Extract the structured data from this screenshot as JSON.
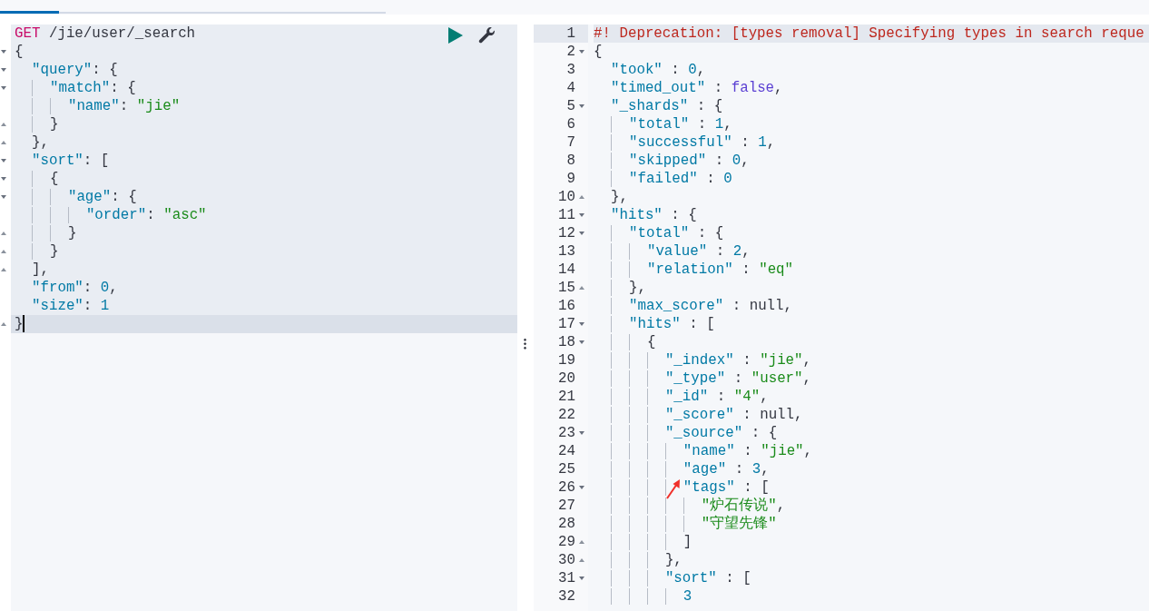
{
  "request_editor": {
    "lines": [
      {
        "kind": "plain",
        "current": false,
        "tokens": [
          {
            "kind": "method",
            "text": "GET"
          },
          {
            "kind": "url",
            "text": " /jie/user/_search"
          }
        ]
      },
      {
        "kind": "open",
        "current": false,
        "tokens": [
          {
            "kind": "punct",
            "text": "{"
          }
        ]
      },
      {
        "kind": "open",
        "current": false,
        "tokens": [
          {
            "kind": "key",
            "text": "  \"query\""
          },
          {
            "kind": "punct",
            "text": ": {"
          }
        ]
      },
      {
        "kind": "open",
        "current": false,
        "tokens": [
          {
            "kind": "key",
            "text": "    \"match\""
          },
          {
            "kind": "punct",
            "text": ": {"
          }
        ]
      },
      {
        "kind": "plain",
        "current": false,
        "tokens": [
          {
            "kind": "key",
            "text": "      \"name\""
          },
          {
            "kind": "punct",
            "text": ": "
          },
          {
            "kind": "string",
            "text": "\"jie\""
          }
        ]
      },
      {
        "kind": "close",
        "current": false,
        "tokens": [
          {
            "kind": "punct",
            "text": "    }"
          }
        ]
      },
      {
        "kind": "close",
        "current": false,
        "tokens": [
          {
            "kind": "punct",
            "text": "  },"
          }
        ]
      },
      {
        "kind": "open",
        "current": false,
        "tokens": [
          {
            "kind": "key",
            "text": "  \"sort\""
          },
          {
            "kind": "punct",
            "text": ": ["
          }
        ]
      },
      {
        "kind": "open",
        "current": false,
        "tokens": [
          {
            "kind": "punct",
            "text": "    {"
          }
        ]
      },
      {
        "kind": "open",
        "current": false,
        "tokens": [
          {
            "kind": "key",
            "text": "      \"age\""
          },
          {
            "kind": "punct",
            "text": ": {"
          }
        ]
      },
      {
        "kind": "plain",
        "current": false,
        "tokens": [
          {
            "kind": "key",
            "text": "        \"order\""
          },
          {
            "kind": "punct",
            "text": ": "
          },
          {
            "kind": "string",
            "text": "\"asc\""
          }
        ]
      },
      {
        "kind": "close",
        "current": false,
        "tokens": [
          {
            "kind": "punct",
            "text": "      }"
          }
        ]
      },
      {
        "kind": "close",
        "current": false,
        "tokens": [
          {
            "kind": "punct",
            "text": "    }"
          }
        ]
      },
      {
        "kind": "close",
        "current": false,
        "tokens": [
          {
            "kind": "punct",
            "text": "  ],"
          }
        ]
      },
      {
        "kind": "plain",
        "current": false,
        "tokens": [
          {
            "kind": "key",
            "text": "  \"from\""
          },
          {
            "kind": "punct",
            "text": ": "
          },
          {
            "kind": "number",
            "text": "0"
          },
          {
            "kind": "punct",
            "text": ","
          }
        ]
      },
      {
        "kind": "plain",
        "current": false,
        "tokens": [
          {
            "kind": "key",
            "text": "  \"size\""
          },
          {
            "kind": "punct",
            "text": ": "
          },
          {
            "kind": "number",
            "text": "1"
          }
        ]
      },
      {
        "kind": "close",
        "current": true,
        "tokens": [
          {
            "kind": "punct",
            "text": "}"
          }
        ]
      }
    ]
  },
  "response_viewer": {
    "lines": [
      {
        "number": "1",
        "kind": "plain",
        "current": true,
        "tokens": [
          {
            "kind": "comment",
            "text": "#! Deprecation: [types removal] Specifying types in search reque"
          }
        ]
      },
      {
        "number": "2",
        "kind": "open",
        "current": false,
        "tokens": [
          {
            "kind": "punct",
            "text": "{"
          }
        ]
      },
      {
        "number": "3",
        "kind": "plain",
        "current": false,
        "tokens": [
          {
            "kind": "key",
            "text": "  \"took\""
          },
          {
            "kind": "punct",
            "text": " : "
          },
          {
            "kind": "number",
            "text": "0"
          },
          {
            "kind": "punct",
            "text": ","
          }
        ]
      },
      {
        "number": "4",
        "kind": "plain",
        "current": false,
        "tokens": [
          {
            "kind": "key",
            "text": "  \"timed_out\""
          },
          {
            "kind": "punct",
            "text": " : "
          },
          {
            "kind": "bool",
            "text": "false"
          },
          {
            "kind": "punct",
            "text": ","
          }
        ]
      },
      {
        "number": "5",
        "kind": "open",
        "current": false,
        "tokens": [
          {
            "kind": "key",
            "text": "  \"_shards\""
          },
          {
            "kind": "punct",
            "text": " : {"
          }
        ]
      },
      {
        "number": "6",
        "kind": "plain",
        "current": false,
        "tokens": [
          {
            "kind": "key",
            "text": "    \"total\""
          },
          {
            "kind": "punct",
            "text": " : "
          },
          {
            "kind": "number",
            "text": "1"
          },
          {
            "kind": "punct",
            "text": ","
          }
        ]
      },
      {
        "number": "7",
        "kind": "plain",
        "current": false,
        "tokens": [
          {
            "kind": "key",
            "text": "    \"successful\""
          },
          {
            "kind": "punct",
            "text": " : "
          },
          {
            "kind": "number",
            "text": "1"
          },
          {
            "kind": "punct",
            "text": ","
          }
        ]
      },
      {
        "number": "8",
        "kind": "plain",
        "current": false,
        "tokens": [
          {
            "kind": "key",
            "text": "    \"skipped\""
          },
          {
            "kind": "punct",
            "text": " : "
          },
          {
            "kind": "number",
            "text": "0"
          },
          {
            "kind": "punct",
            "text": ","
          }
        ]
      },
      {
        "number": "9",
        "kind": "plain",
        "current": false,
        "tokens": [
          {
            "kind": "key",
            "text": "    \"failed\""
          },
          {
            "kind": "punct",
            "text": " : "
          },
          {
            "kind": "number",
            "text": "0"
          }
        ]
      },
      {
        "number": "10",
        "kind": "close",
        "current": false,
        "tokens": [
          {
            "kind": "punct",
            "text": "  },"
          }
        ]
      },
      {
        "number": "11",
        "kind": "open",
        "current": false,
        "tokens": [
          {
            "kind": "key",
            "text": "  \"hits\""
          },
          {
            "kind": "punct",
            "text": " : {"
          }
        ]
      },
      {
        "number": "12",
        "kind": "open",
        "current": false,
        "tokens": [
          {
            "kind": "key",
            "text": "    \"total\""
          },
          {
            "kind": "punct",
            "text": " : {"
          }
        ]
      },
      {
        "number": "13",
        "kind": "plain",
        "current": false,
        "tokens": [
          {
            "kind": "key",
            "text": "      \"value\""
          },
          {
            "kind": "punct",
            "text": " : "
          },
          {
            "kind": "number",
            "text": "2"
          },
          {
            "kind": "punct",
            "text": ","
          }
        ]
      },
      {
        "number": "14",
        "kind": "plain",
        "current": false,
        "tokens": [
          {
            "kind": "key",
            "text": "      \"relation\""
          },
          {
            "kind": "punct",
            "text": " : "
          },
          {
            "kind": "string",
            "text": "\"eq\""
          }
        ]
      },
      {
        "number": "15",
        "kind": "close",
        "current": false,
        "tokens": [
          {
            "kind": "punct",
            "text": "    },"
          }
        ]
      },
      {
        "number": "16",
        "kind": "plain",
        "current": false,
        "tokens": [
          {
            "kind": "key",
            "text": "    \"max_score\""
          },
          {
            "kind": "punct",
            "text": " : null,"
          }
        ]
      },
      {
        "number": "17",
        "kind": "open",
        "current": false,
        "tokens": [
          {
            "kind": "key",
            "text": "    \"hits\""
          },
          {
            "kind": "punct",
            "text": " : ["
          }
        ]
      },
      {
        "number": "18",
        "kind": "open",
        "current": false,
        "tokens": [
          {
            "kind": "punct",
            "text": "      {"
          }
        ]
      },
      {
        "number": "19",
        "kind": "plain",
        "current": false,
        "tokens": [
          {
            "kind": "key",
            "text": "        \"_index\""
          },
          {
            "kind": "punct",
            "text": " : "
          },
          {
            "kind": "string",
            "text": "\"jie\""
          },
          {
            "kind": "punct",
            "text": ","
          }
        ]
      },
      {
        "number": "20",
        "kind": "plain",
        "current": false,
        "tokens": [
          {
            "kind": "key",
            "text": "        \"_type\""
          },
          {
            "kind": "punct",
            "text": " : "
          },
          {
            "kind": "string",
            "text": "\"user\""
          },
          {
            "kind": "punct",
            "text": ","
          }
        ]
      },
      {
        "number": "21",
        "kind": "plain",
        "current": false,
        "tokens": [
          {
            "kind": "key",
            "text": "        \"_id\""
          },
          {
            "kind": "punct",
            "text": " : "
          },
          {
            "kind": "string",
            "text": "\"4\""
          },
          {
            "kind": "punct",
            "text": ","
          }
        ]
      },
      {
        "number": "22",
        "kind": "plain",
        "current": false,
        "tokens": [
          {
            "kind": "key",
            "text": "        \"_score\""
          },
          {
            "kind": "punct",
            "text": " : null,"
          }
        ]
      },
      {
        "number": "23",
        "kind": "open",
        "current": false,
        "tokens": [
          {
            "kind": "key",
            "text": "        \"_source\""
          },
          {
            "kind": "punct",
            "text": " : {"
          }
        ]
      },
      {
        "number": "24",
        "kind": "plain",
        "current": false,
        "tokens": [
          {
            "kind": "key",
            "text": "          \"name\""
          },
          {
            "kind": "punct",
            "text": " : "
          },
          {
            "kind": "string",
            "text": "\"jie\""
          },
          {
            "kind": "punct",
            "text": ","
          }
        ]
      },
      {
        "number": "25",
        "kind": "plain",
        "current": false,
        "tokens": [
          {
            "kind": "key",
            "text": "          \"age\""
          },
          {
            "kind": "punct",
            "text": " : "
          },
          {
            "kind": "number",
            "text": "3"
          },
          {
            "kind": "punct",
            "text": ","
          }
        ]
      },
      {
        "number": "26",
        "kind": "open",
        "current": false,
        "tokens": [
          {
            "kind": "key",
            "text": "          \"tags\""
          },
          {
            "kind": "punct",
            "text": " : ["
          }
        ]
      },
      {
        "number": "27",
        "kind": "plain",
        "current": false,
        "tokens": [
          {
            "kind": "string",
            "text": "            \"炉石传说\""
          },
          {
            "kind": "punct",
            "text": ","
          }
        ]
      },
      {
        "number": "28",
        "kind": "plain",
        "current": false,
        "tokens": [
          {
            "kind": "string",
            "text": "            \"守望先锋\""
          }
        ]
      },
      {
        "number": "29",
        "kind": "close",
        "current": false,
        "tokens": [
          {
            "kind": "punct",
            "text": "          ]"
          }
        ]
      },
      {
        "number": "30",
        "kind": "close",
        "current": false,
        "tokens": [
          {
            "kind": "punct",
            "text": "        },"
          }
        ]
      },
      {
        "number": "31",
        "kind": "open",
        "current": false,
        "tokens": [
          {
            "kind": "key",
            "text": "        \"sort\""
          },
          {
            "kind": "punct",
            "text": " : ["
          }
        ]
      },
      {
        "number": "32",
        "kind": "plain",
        "current": false,
        "tokens": [
          {
            "kind": "number",
            "text": "          3"
          }
        ]
      }
    ]
  }
}
